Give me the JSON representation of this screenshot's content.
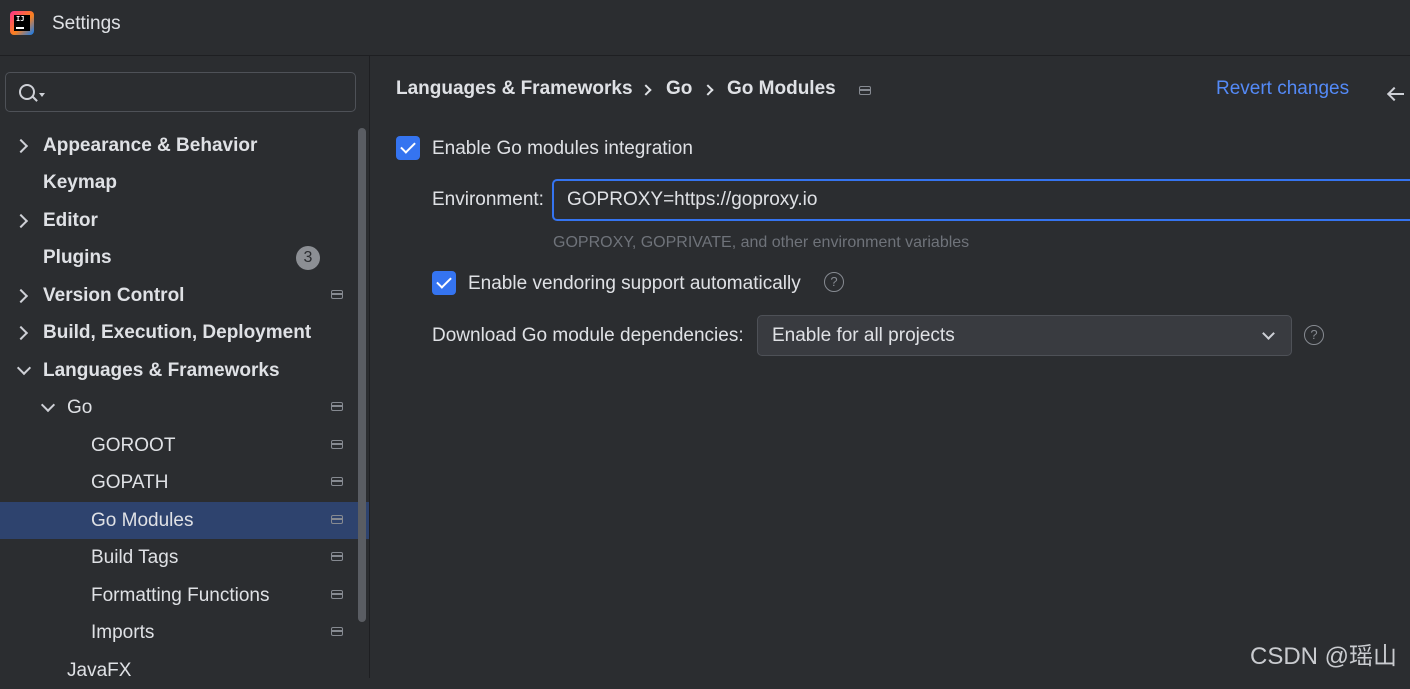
{
  "window": {
    "title": "Settings",
    "logo_icon": "jetbrains-ij-logo"
  },
  "search": {
    "value": "",
    "placeholder": ""
  },
  "sidebar": {
    "items": [
      {
        "label": "Appearance & Behavior",
        "expanded": false
      },
      {
        "label": "Keymap"
      },
      {
        "label": "Editor",
        "expanded": false
      },
      {
        "label": "Plugins",
        "badge": "3"
      },
      {
        "label": "Version Control",
        "expanded": false
      },
      {
        "label": "Build, Execution, Deployment",
        "expanded": false
      },
      {
        "label": "Languages & Frameworks",
        "expanded": true
      },
      {
        "label": "Go",
        "expanded": true
      },
      {
        "label": "GOROOT"
      },
      {
        "label": "GOPATH"
      },
      {
        "label": "Go Modules",
        "selected": true
      },
      {
        "label": "Build Tags"
      },
      {
        "label": "Formatting Functions"
      },
      {
        "label": "Imports"
      },
      {
        "label": "JavaFX"
      }
    ]
  },
  "breadcrumb": [
    "Languages & Frameworks",
    "Go",
    "Go Modules"
  ],
  "header": {
    "revert_label": "Revert changes"
  },
  "form": {
    "enable_modules": {
      "label": "Enable Go modules integration",
      "checked": true
    },
    "environment": {
      "label": "Environment:",
      "value": "GOPROXY=https://goproxy.io",
      "hint": "GOPROXY, GOPRIVATE, and other environment variables"
    },
    "vendoring": {
      "label": "Enable vendoring support automatically",
      "checked": true
    },
    "download": {
      "label": "Download Go module dependencies:",
      "value": "Enable for all projects"
    }
  },
  "watermark": "CSDN @瑶山",
  "colors": {
    "accent": "#3574f0",
    "link": "#548af7",
    "selection": "#2e436e",
    "background": "#2b2d30"
  }
}
